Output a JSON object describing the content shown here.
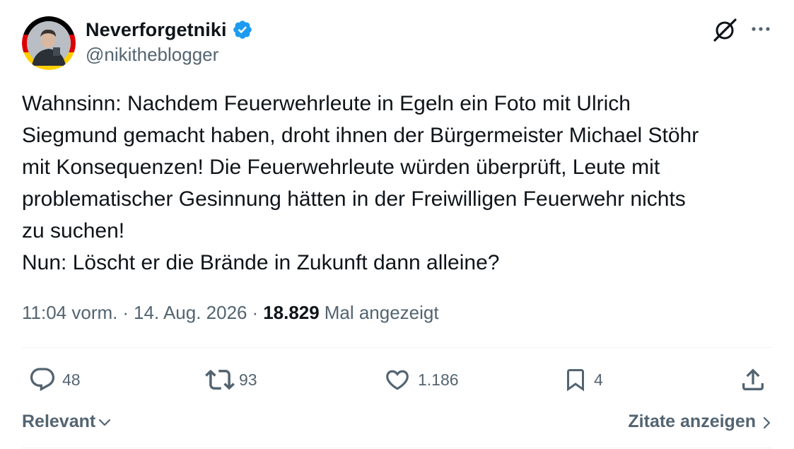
{
  "author": {
    "display_name": "Neverforgetniki",
    "handle": "@nikitheblogger",
    "verified": true,
    "verified_color": "#1d9bf0",
    "avatar_ring_colors": [
      "#000000",
      "#dd0000",
      "#ffce00"
    ]
  },
  "header_icons": {
    "grok": "grok-icon",
    "more": "more-icon"
  },
  "tweet": {
    "text": "Wahnsinn: Nachdem Feuerwehrleute in Egeln ein Foto mit Ulrich\nSiegmund gemacht haben, droht ihnen der Bürgermeister Michael Stöhr\nmit Konsequenzen! Die Feuerwehrleute würden überprüft, Leute mit\nproblematischer Gesinnung hätten in der Freiwilligen Feuerwehr nichts\nzu suchen!\nNun: Löscht er die Brände in Zukunft dann alleine?"
  },
  "meta": {
    "time": "11:04 vorm.",
    "separator": "·",
    "date": "14. Aug. 2026",
    "views_count": "18.829",
    "views_label": "Mal angezeigt"
  },
  "actions": {
    "replies": {
      "icon": "reply-icon",
      "count": "48"
    },
    "reposts": {
      "icon": "repost-icon",
      "count": "93"
    },
    "likes": {
      "icon": "heart-icon",
      "count": "1.186"
    },
    "bookmarks": {
      "icon": "bookmark-icon",
      "count": "4"
    },
    "share": {
      "icon": "share-icon"
    }
  },
  "footer": {
    "sort_label": "Relevant",
    "quotes_label": "Zitate anzeigen"
  },
  "colors": {
    "text_primary": "#0f1419",
    "text_secondary": "#536471",
    "divider": "#eff3f4"
  }
}
